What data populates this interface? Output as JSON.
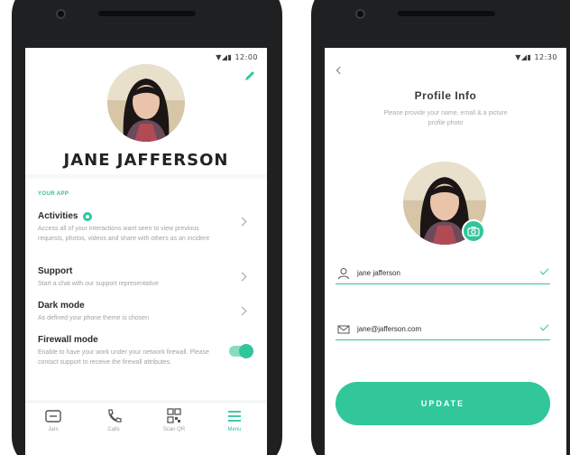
{
  "colors": {
    "accent": "#30c59b",
    "phone_body": "#1e2021"
  },
  "profile_screen": {
    "status_time": "12:00",
    "name": "JANE JAFFERSON",
    "section_title": "YOUR APP",
    "items": [
      {
        "title": "Activities",
        "description": "Access all of your interactions want seen to view previous requests, photos, videos and share with others as an incident"
      },
      {
        "title": "Support",
        "description": "Start a chat with our support representative"
      },
      {
        "title": "Dark mode",
        "description": "As defined your phone theme is chosen"
      },
      {
        "title": "Firewall mode",
        "description": "Enable to have your work under your network firewall. Please contact support to receive the firewall attributes."
      }
    ],
    "firewall_enabled": true,
    "nav": [
      {
        "label": "Jars",
        "icon": "wallet-icon"
      },
      {
        "label": "Calls",
        "icon": "phone-icon"
      },
      {
        "label": "Scan QR",
        "icon": "qr-icon"
      },
      {
        "label": "Menu",
        "icon": "menu-icon"
      }
    ]
  },
  "info_screen": {
    "status_time": "12:30",
    "title": "Profile Info",
    "subtitle": "Please provide your name, email & a picture profile photo",
    "name_value": "jane jafferson",
    "email_value": "jane@jafferson.com",
    "update_label": "UPDATE"
  }
}
